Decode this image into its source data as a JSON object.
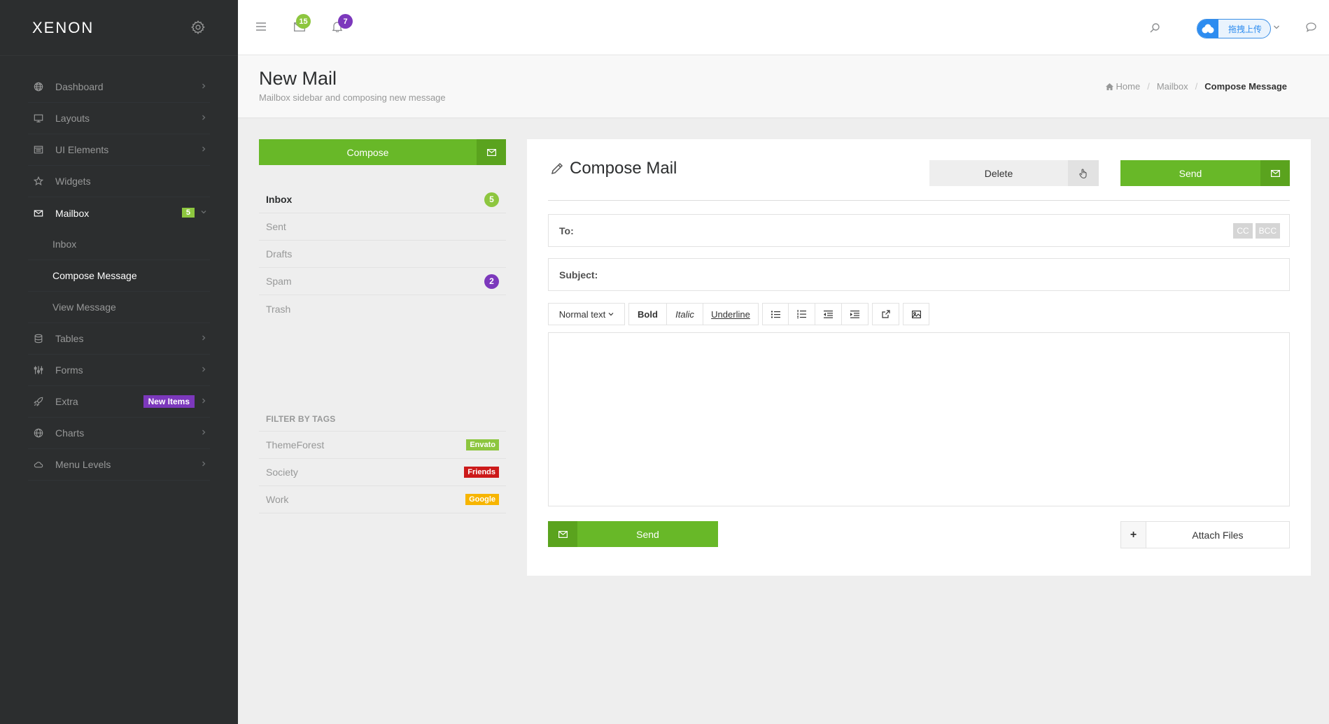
{
  "app": {
    "logo": "XENON"
  },
  "sidebar": {
    "items": [
      {
        "label": "Dashboard",
        "icon": "globe-icon"
      },
      {
        "label": "Layouts",
        "icon": "monitor-icon"
      },
      {
        "label": "UI Elements",
        "icon": "window-icon"
      },
      {
        "label": "Widgets",
        "icon": "star-icon"
      },
      {
        "label": "Mailbox",
        "icon": "envelope-icon",
        "badge": "5"
      },
      {
        "label": "Tables",
        "icon": "database-icon"
      },
      {
        "label": "Forms",
        "icon": "sliders-icon"
      },
      {
        "label": "Extra",
        "icon": "rocket-icon",
        "badge": "New Items"
      },
      {
        "label": "Charts",
        "icon": "globe-icon"
      },
      {
        "label": "Menu Levels",
        "icon": "cloud-icon"
      }
    ],
    "mailbox_sub": [
      "Inbox",
      "Compose Message",
      "View Message"
    ]
  },
  "topbar": {
    "messages_count": "15",
    "notifications_count": "7",
    "upload_label": "拖拽上传",
    "colors": {
      "messages_badge": "#8dc63f",
      "notifications_badge": "#7c38bc"
    }
  },
  "page": {
    "title": "New Mail",
    "subtitle": "Mailbox sidebar and composing new message",
    "breadcrumb": {
      "home": "Home",
      "mailbox": "Mailbox",
      "current": "Compose Message"
    }
  },
  "mail_sidebar": {
    "compose_label": "Compose",
    "folders": [
      {
        "label": "Inbox",
        "count": "5",
        "color": "#8dc63f"
      },
      {
        "label": "Sent"
      },
      {
        "label": "Drafts"
      },
      {
        "label": "Spam",
        "count": "2",
        "color": "#7c38bc"
      },
      {
        "label": "Trash"
      }
    ],
    "filter_title": "FILTER BY TAGS",
    "tags": [
      {
        "label": "ThemeForest",
        "tag": "Envato",
        "color": "#8dc63f"
      },
      {
        "label": "Society",
        "tag": "Friends",
        "color": "#cc3f44"
      },
      {
        "label": "Work",
        "tag": "Google",
        "color": "#fcd036"
      }
    ]
  },
  "compose": {
    "title": "Compose Mail",
    "delete_label": "Delete",
    "send_label": "Send",
    "to_label": "To:",
    "cc_label": "CC",
    "bcc_label": "BCC",
    "subject_label": "Subject:",
    "toolbar": {
      "style": "Normal text",
      "bold": "Bold",
      "italic": "Italic",
      "underline": "Underline"
    },
    "send_bottom_label": "Send",
    "attach_label": "Attach Files",
    "attach_icon_label": "+"
  },
  "colors": {
    "accent": "#68b828",
    "sidebar_bg": "#2c2e2f"
  }
}
